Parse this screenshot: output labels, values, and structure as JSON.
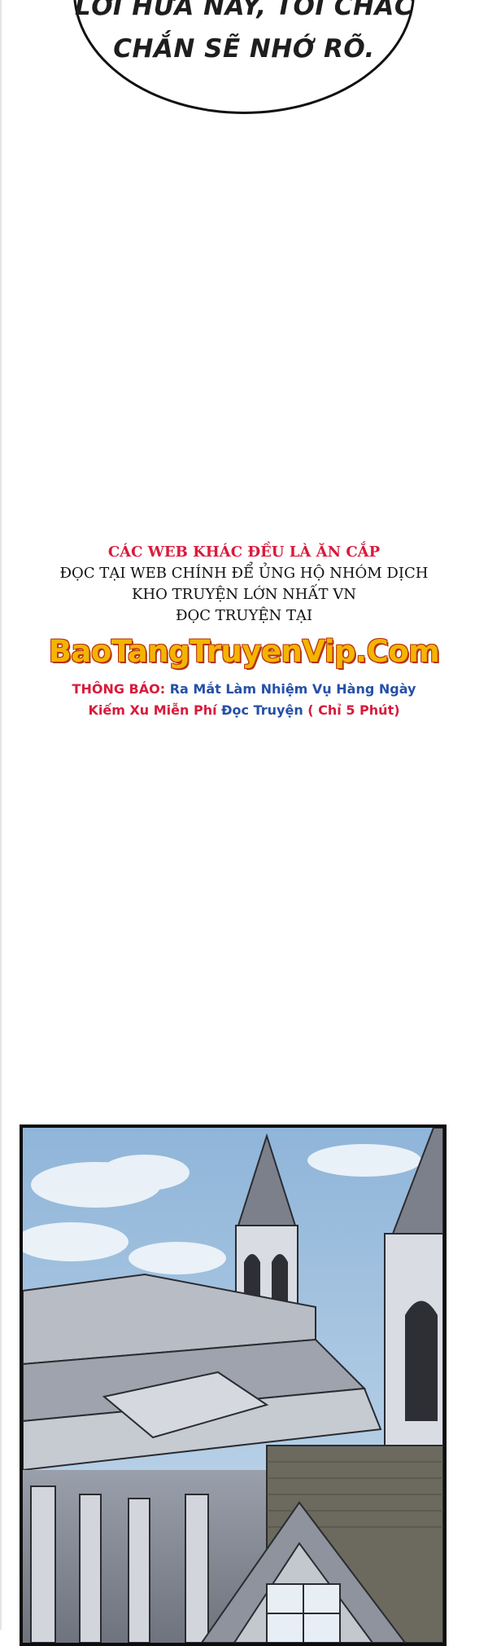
{
  "speech_bubble": {
    "line1": "LỜI HỨA NÀY, TÔI CHẮC",
    "line2": "CHẮN SẼ NHỚ RÕ."
  },
  "notice": {
    "warning": "CÁC WEB KHÁC ĐỀU LÀ ĂN CẮP",
    "line2": "ĐỌC TẠI WEB CHÍNH ĐỂ ỦNG HỘ NHÓM DỊCH",
    "line3": "KHO TRUYỆN LỚN NHẤT VN",
    "line4": "ĐỌC TRUYỆN TẠI",
    "site": "BaoTangTruyenVip.Com",
    "announce_label": "THÔNG BÁO:",
    "announce_blue_1": "Ra Mắt Làm Nhiệm Vụ Hàng Ngày",
    "announce_red_2": "Kiếm Xu Miễn Phí",
    "announce_blue_2": "Đọc Truyện",
    "announce_red_3": "( Chỉ 5 Phút)"
  },
  "colors": {
    "warning_red": "#d81b3c",
    "announce_blue": "#2550a8",
    "site_yellow": "#f4b400",
    "site_outline": "#b6330e",
    "sky": "#a9c6e0"
  },
  "illustration": {
    "subject": "castle-building-under-sky"
  }
}
